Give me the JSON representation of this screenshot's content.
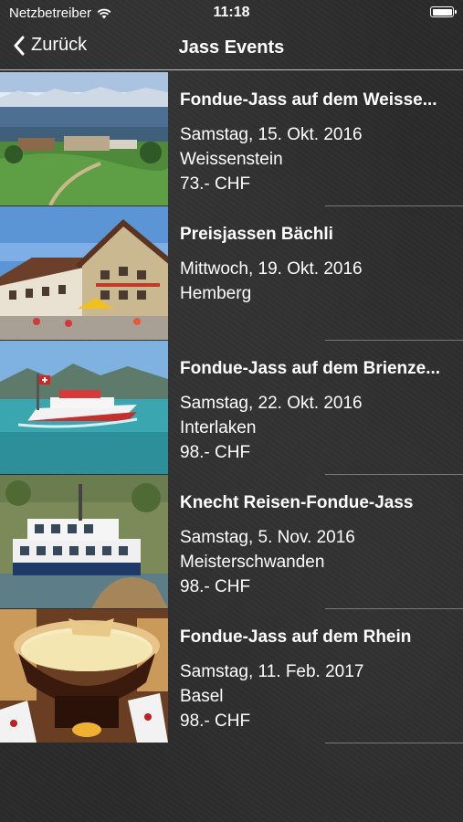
{
  "status": {
    "carrier": "Netzbetreiber",
    "time": "11:18"
  },
  "nav": {
    "back_label": "Zurück",
    "title": "Jass Events"
  },
  "events": [
    {
      "title": "Fondue-Jass auf dem Weisse...",
      "date": "Samstag, 15. Okt. 2016",
      "location": "Weissenstein",
      "price": "73.- CHF",
      "image": "mountain-landscape"
    },
    {
      "title": "Preisjassen Bächli",
      "date": "Mittwoch, 19. Okt. 2016",
      "location": "Hemberg",
      "price": "",
      "image": "village-inn"
    },
    {
      "title": "Fondue-Jass auf dem Brienze...",
      "date": "Samstag, 22. Okt. 2016",
      "location": "Interlaken",
      "price": "98.- CHF",
      "image": "lake-ship"
    },
    {
      "title": "Knecht Reisen-Fondue-Jass",
      "date": "Samstag, 5. Nov. 2016",
      "location": "Meisterschwanden",
      "price": "98.- CHF",
      "image": "lake-steamer"
    },
    {
      "title": "Fondue-Jass auf dem Rhein",
      "date": "Samstag, 11. Feb. 2017",
      "location": "Basel",
      "price": "98.- CHF",
      "image": "fondue-pot"
    }
  ]
}
